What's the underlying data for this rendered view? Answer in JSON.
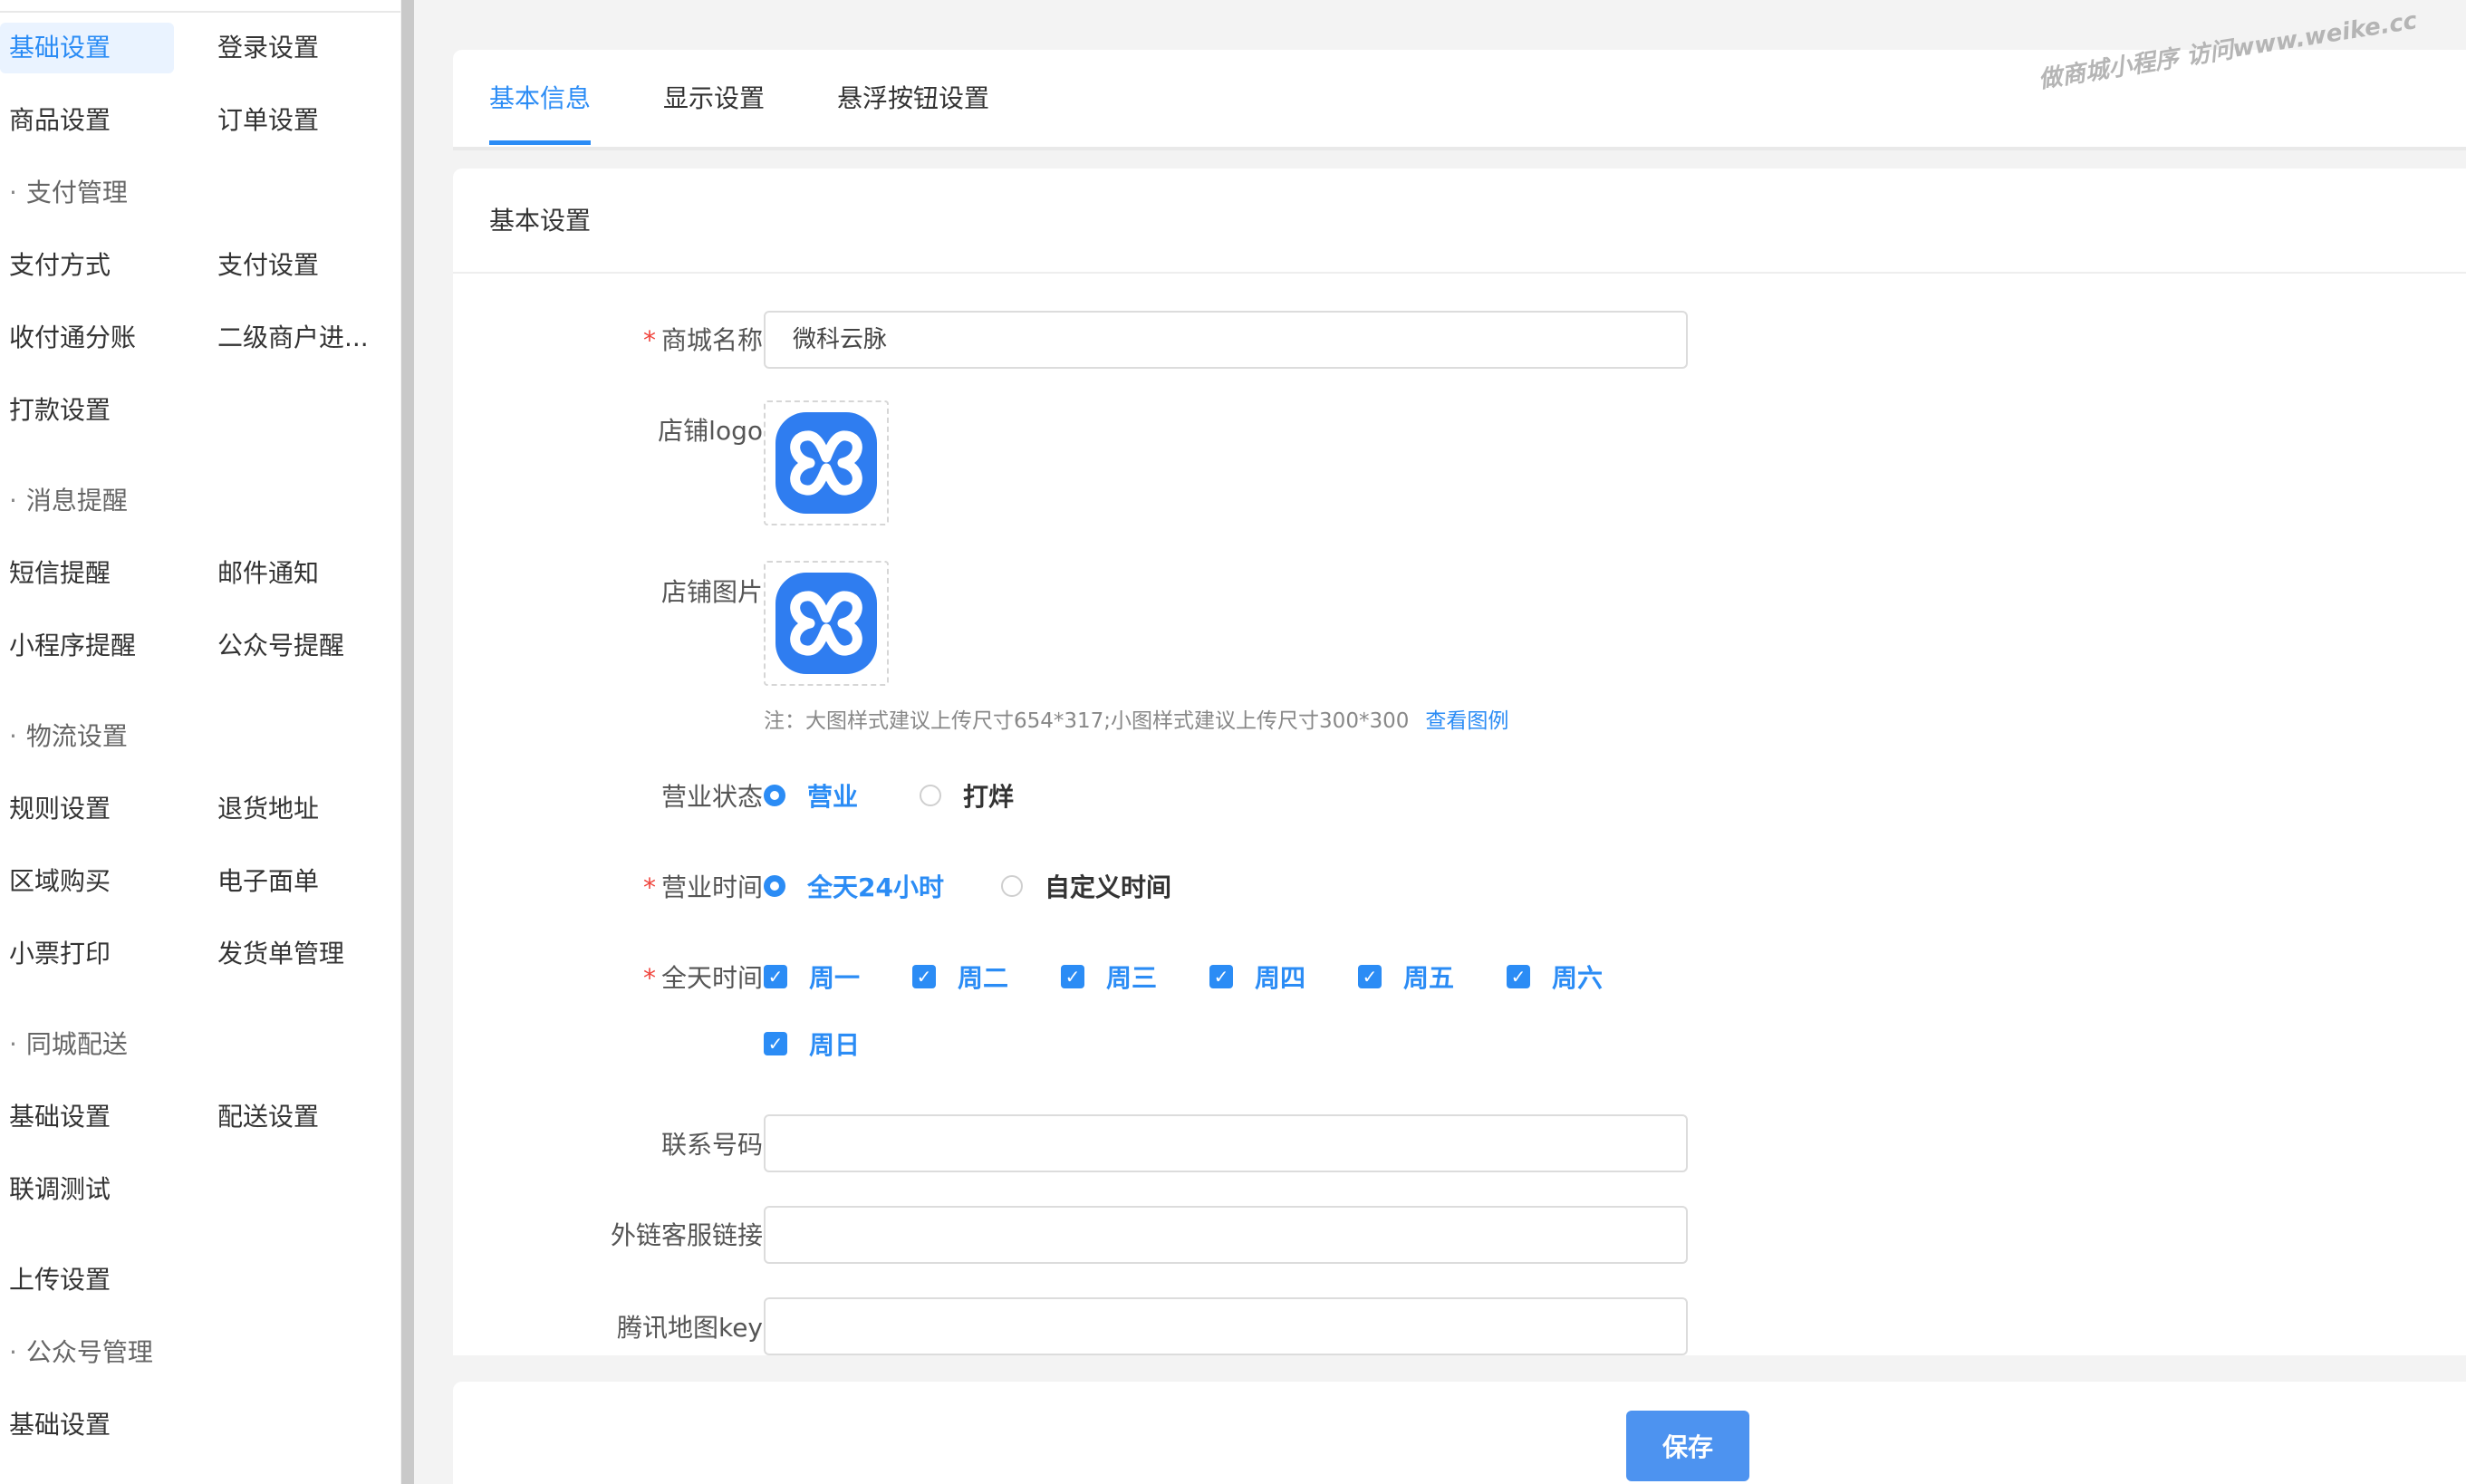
{
  "sidebar": {
    "items": [
      {
        "label": "基础设置",
        "active": true
      },
      {
        "label": "登录设置"
      },
      {
        "label": "商品设置"
      },
      {
        "label": "订单设置"
      },
      {
        "label": "支付方式"
      },
      {
        "label": "支付设置"
      },
      {
        "label": "收付通分账"
      },
      {
        "label": "二级商户进..."
      },
      {
        "label": "打款设置"
      },
      {
        "label": "短信提醒"
      },
      {
        "label": "邮件通知"
      },
      {
        "label": "小程序提醒"
      },
      {
        "label": "公众号提醒"
      },
      {
        "label": "规则设置"
      },
      {
        "label": "退货地址"
      },
      {
        "label": "区域购买"
      },
      {
        "label": "电子面单"
      },
      {
        "label": "小票打印"
      },
      {
        "label": "发货单管理"
      },
      {
        "label": "基础设置"
      },
      {
        "label": "配送设置"
      },
      {
        "label": "联调测试"
      },
      {
        "label": "上传设置"
      },
      {
        "label": "基础设置"
      }
    ],
    "sections": [
      "支付管理",
      "消息提醒",
      "物流设置",
      "同城配送",
      "公众号管理"
    ],
    "section_dot": "·"
  },
  "tabs": [
    {
      "label": "基本信息",
      "active": true
    },
    {
      "label": "显示设置"
    },
    {
      "label": "悬浮按钮设置"
    }
  ],
  "watermark": "做商城小程序 访问www.weike.cc",
  "form": {
    "section_title": "基本设置",
    "required_mark": "*",
    "shop_name": {
      "label": "商城名称",
      "value": "微科云脉",
      "required": true
    },
    "shop_logo": {
      "label": "店铺logo"
    },
    "shop_image": {
      "label": "店铺图片"
    },
    "image_note": "注：大图样式建议上传尺寸654*317;小图样式建议上传尺寸300*300",
    "image_note_link": "查看图例",
    "business_status": {
      "label": "营业状态",
      "options": [
        "营业",
        "打烊"
      ],
      "selected": "营业"
    },
    "business_hours": {
      "label": "营业时间",
      "options": [
        "全天24小时",
        "自定义时间"
      ],
      "selected": "全天24小时",
      "required": true
    },
    "all_day": {
      "label": "全天时间",
      "required": true,
      "days": [
        "周一",
        "周二",
        "周三",
        "周四",
        "周五",
        "周六",
        "周日"
      ],
      "checked": [
        true,
        true,
        true,
        true,
        true,
        true,
        true
      ]
    },
    "phone": {
      "label": "联系号码",
      "value": ""
    },
    "service_link": {
      "label": "外链客服链接",
      "value": ""
    },
    "map_key": {
      "label": "腾讯地图key",
      "value": ""
    }
  },
  "footer": {
    "save_label": "保存"
  },
  "colors": {
    "accent": "#2b8cf5",
    "required": "#f0443c",
    "logo_bg": "#2f7df0"
  },
  "icons": {
    "logo": "wk-logo-icon",
    "check": "check-icon"
  }
}
